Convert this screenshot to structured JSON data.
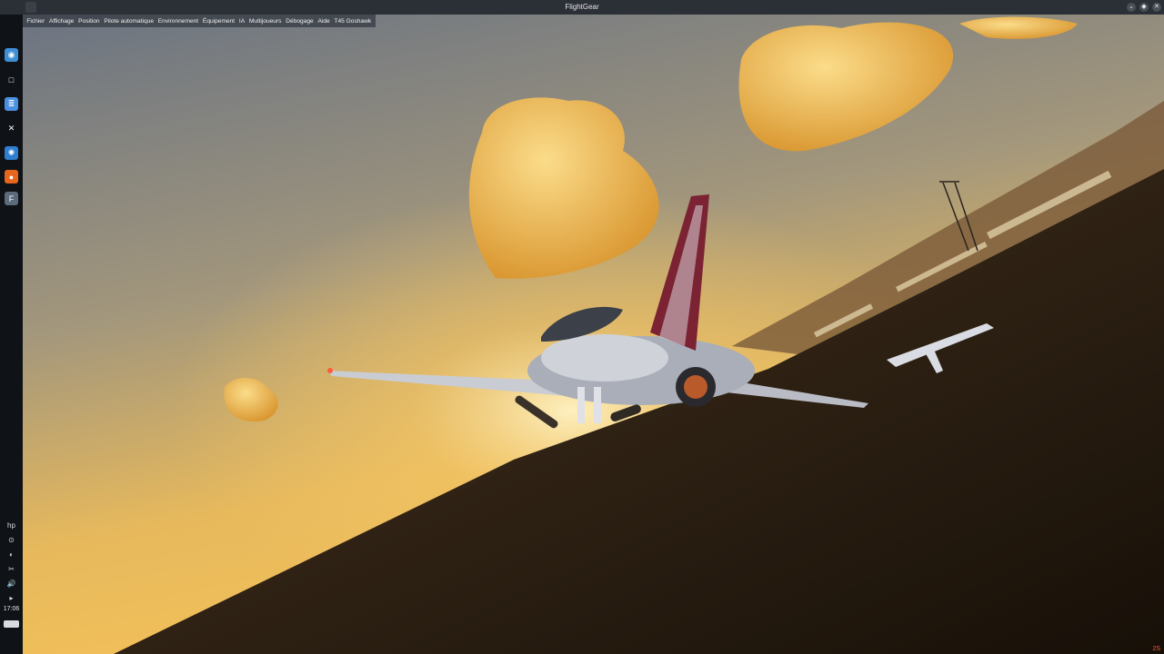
{
  "window": {
    "title": "FlightGear"
  },
  "window_controls": {
    "minimize": "⌄",
    "maximize": "◆",
    "close": "✕"
  },
  "menubar": {
    "items": [
      "Fichier",
      "Affichage",
      "Position",
      "Pilote automatique",
      "Environnement",
      "Équipement",
      "IA",
      "Multijoueurs",
      "Débogage",
      "Aide",
      "T45 Goshawk"
    ]
  },
  "dock": {
    "launchers": [
      {
        "icon": "app-launcher-icon",
        "glyph": "◉",
        "color": "#3d8fd6"
      },
      {
        "icon": "desktop-icon",
        "glyph": "□",
        "color": "#0f1216"
      },
      {
        "icon": "text-editor-icon",
        "glyph": "≣",
        "color": "#4a90e2"
      },
      {
        "icon": "tools-icon",
        "glyph": "✕",
        "color": "#0f1216"
      },
      {
        "icon": "settings-gear-icon",
        "glyph": "✺",
        "color": "#2f7fd0"
      },
      {
        "icon": "firefox-icon",
        "glyph": "●",
        "color": "#e8651e"
      },
      {
        "icon": "flightgear-icon",
        "glyph": "F",
        "color": "#5b6b7c"
      }
    ],
    "tray": [
      {
        "icon": "hp-icon",
        "glyph": "hp"
      },
      {
        "icon": "network-icon",
        "glyph": "⊙"
      },
      {
        "icon": "chat-icon",
        "glyph": "◐"
      },
      {
        "icon": "scissors-icon",
        "glyph": "✂"
      },
      {
        "icon": "volume-icon",
        "glyph": "🔊"
      },
      {
        "icon": "expand-arrow-icon",
        "glyph": "▸"
      }
    ],
    "clock": "17:06"
  },
  "status": {
    "corner_readout": "2S"
  },
  "scene": {
    "sky_top": "#6f7785",
    "sky_horizon": "#f3c35a",
    "ground": "#3a2a16",
    "cloud": "#f1b94a",
    "aircraft_body": "#c9ccd3",
    "tail": "#7b2333"
  }
}
